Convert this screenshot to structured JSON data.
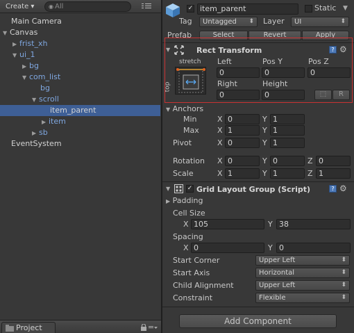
{
  "hierarchy": {
    "create_label": "Create",
    "create_arrow": "▾",
    "search_placeholder": "All",
    "search_icon": "◉",
    "items": [
      {
        "label": "Main Camera",
        "arrow": ""
      },
      {
        "label": "Canvas",
        "arrow": "▼"
      },
      {
        "label": "frist_xh",
        "arrow": "▶"
      },
      {
        "label": "ui_1",
        "arrow": "▼"
      },
      {
        "label": "bg",
        "arrow": "▶"
      },
      {
        "label": "com_list",
        "arrow": "▼"
      },
      {
        "label": "bg",
        "arrow": ""
      },
      {
        "label": "scroll",
        "arrow": "▼"
      },
      {
        "label": "item_parent",
        "arrow": ""
      },
      {
        "label": "item",
        "arrow": "▶"
      },
      {
        "label": "sb",
        "arrow": "▶"
      },
      {
        "label": "EventSystem",
        "arrow": ""
      }
    ]
  },
  "project_tab": {
    "label": "Project"
  },
  "inspector": {
    "object_name": "item_parent",
    "static_label": "Static",
    "tag_label": "Tag",
    "tag_value": "Untagged",
    "layer_label": "Layer",
    "layer_value": "UI",
    "prefab_label": "Prefab",
    "prefab_select": "Select",
    "prefab_revert": "Revert",
    "prefab_apply": "Apply",
    "rect_transform": {
      "title": "Rect Transform",
      "anchor_h": "stretch",
      "anchor_v": "top",
      "left_label": "Left",
      "left_value": "0",
      "posy_label": "Pos Y",
      "posy_value": "0",
      "posz_label": "Pos Z",
      "posz_value": "0",
      "right_label": "Right",
      "right_value": "0",
      "height_label": "Height",
      "height_value": "0",
      "blueprint_btn": "⬚",
      "raw_btn": "R",
      "anchors_label": "Anchors",
      "min_label": "Min",
      "min_x": "0",
      "min_y": "1",
      "max_label": "Max",
      "max_x": "1",
      "max_y": "1",
      "pivot_label": "Pivot",
      "pivot_x": "0",
      "pivot_y": "1",
      "rotation_label": "Rotation",
      "rot_x": "0",
      "rot_y": "0",
      "rot_z": "0",
      "scale_label": "Scale",
      "scale_x": "1",
      "scale_y": "1",
      "scale_z": "1",
      "x": "X",
      "y": "Y",
      "z": "Z"
    },
    "grid_layout": {
      "title": "Grid Layout Group (Script)",
      "padding_label": "Padding",
      "cell_size_label": "Cell Size",
      "cell_x": "105",
      "cell_y": "38",
      "spacing_label": "Spacing",
      "spacing_x": "0",
      "spacing_y": "0",
      "start_corner_label": "Start Corner",
      "start_corner_value": "Upper Left",
      "start_axis_label": "Start Axis",
      "start_axis_value": "Horizontal",
      "child_alignment_label": "Child Alignment",
      "child_alignment_value": "Upper Left",
      "constraint_label": "Constraint",
      "constraint_value": "Flexible"
    },
    "add_component_label": "Add Component"
  },
  "colors": {
    "selection": "#3e5f96",
    "highlight_border": "#c83232",
    "blue_text": "#7fa7e0"
  }
}
